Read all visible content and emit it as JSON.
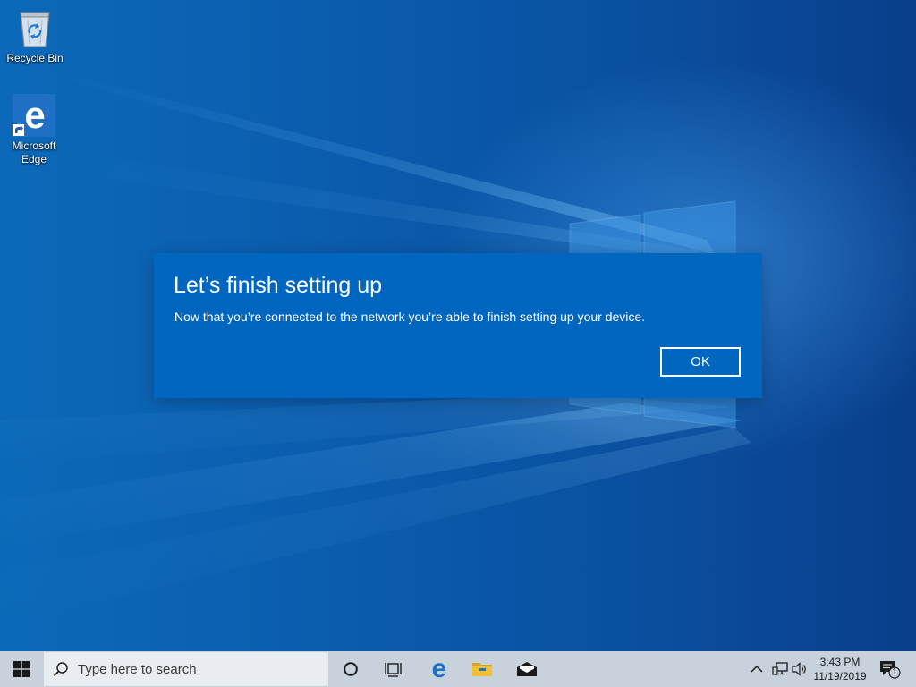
{
  "desktop": {
    "icons": [
      {
        "label": "Recycle Bin",
        "icon": "recycle-bin-icon"
      },
      {
        "label": "Microsoft Edge",
        "icon": "edge-icon",
        "shortcut": true
      }
    ]
  },
  "dialog": {
    "title": "Let’s finish setting up",
    "message": "Now that you’re connected to the network you’re able to finish setting up your device.",
    "ok_label": "OK"
  },
  "taskbar": {
    "start_icon": "windows-logo-icon",
    "search_placeholder": "Type here to search",
    "pinned": [
      {
        "icon": "cortana-circle-icon"
      },
      {
        "icon": "task-view-icon"
      },
      {
        "icon": "edge-icon"
      },
      {
        "icon": "folder-icon"
      },
      {
        "icon": "mail-icon"
      }
    ],
    "tray": {
      "icons": [
        "chevron-up-icon",
        "network-icon",
        "volume-icon",
        "notification-icon"
      ],
      "time": "3:43 PM",
      "date": "11/19/2019",
      "notification_count": "1"
    }
  },
  "colors": {
    "desktop_blue": "#0b5dae",
    "dialog_blue": "#0066c0",
    "taskbar_gray": "#c8d2dc",
    "edge_blue": "#1f6fc5",
    "folder_yellow": "#f3c033"
  }
}
